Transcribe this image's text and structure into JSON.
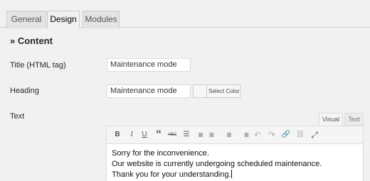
{
  "tabs": [
    {
      "label": "General",
      "active": false
    },
    {
      "label": "Design",
      "active": true
    },
    {
      "label": "Modules",
      "active": false
    }
  ],
  "section": {
    "title": "» Content"
  },
  "fields": {
    "title": {
      "label": "Title (HTML tag)",
      "value": "Maintenance mode"
    },
    "heading": {
      "label": "Heading",
      "value": "Maintenance mode"
    },
    "color_button_label": "Select Color",
    "text": {
      "label": "Text"
    }
  },
  "editor": {
    "tabs": {
      "visual": "Visual",
      "text": "Text"
    },
    "toolbar": [
      {
        "name": "bold-icon",
        "glyph": "B"
      },
      {
        "name": "italic-icon",
        "glyph": "I"
      },
      {
        "name": "underline-icon",
        "glyph": "U"
      },
      {
        "name": "blockquote-icon",
        "glyph": "“"
      },
      {
        "name": "strikethrough-icon",
        "glyph": "ABC"
      },
      {
        "name": "bullet-list-icon",
        "glyph": "☰"
      },
      {
        "name": "numbered-list-icon",
        "glyph": "≡"
      },
      {
        "name": "align-left-icon",
        "glyph": "≡"
      },
      {
        "name": "align-center-icon",
        "glyph": "≡"
      },
      {
        "name": "align-right-icon",
        "glyph": "≡"
      },
      {
        "name": "undo-icon",
        "glyph": "↶"
      },
      {
        "name": "redo-icon",
        "glyph": "↷"
      },
      {
        "name": "link-icon",
        "glyph": "🔗"
      },
      {
        "name": "unlink-icon",
        "glyph": "⛓"
      },
      {
        "name": "fullscreen-icon",
        "glyph": "⤢"
      }
    ],
    "content_lines": [
      "Sorry for the inconvenience.",
      "Our website is currently undergoing scheduled maintenance.",
      "Thank you for your understanding."
    ]
  }
}
